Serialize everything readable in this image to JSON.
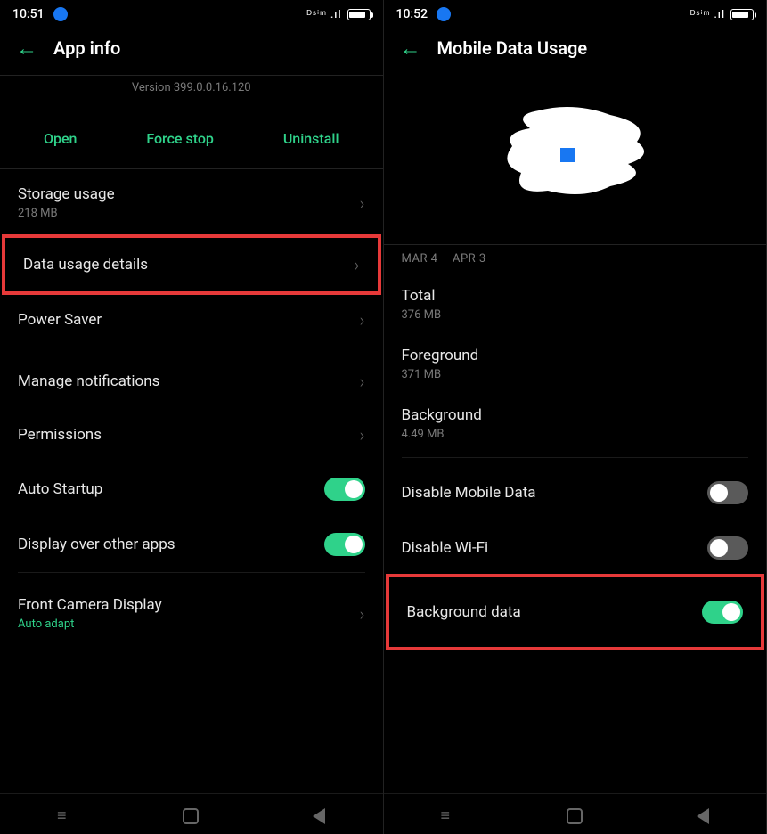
{
  "left": {
    "status": {
      "time": "10:51",
      "signal": "ᴰˢⁱᵐ .ıl"
    },
    "header": {
      "title": "App info"
    },
    "app": {
      "name": "",
      "version": "Version 399.0.0.16.120"
    },
    "actions": {
      "open": "Open",
      "force_stop": "Force stop",
      "uninstall": "Uninstall"
    },
    "items": {
      "storage": {
        "label": "Storage usage",
        "sub": "218 MB"
      },
      "data_usage": {
        "label": "Data usage details"
      },
      "power_saver": {
        "label": "Power Saver"
      },
      "notifications": {
        "label": "Manage notifications"
      },
      "permissions": {
        "label": "Permissions"
      },
      "auto_startup": {
        "label": "Auto Startup"
      },
      "display_over": {
        "label": "Display over other apps"
      },
      "front_camera": {
        "label": "Front Camera Display",
        "sub": "Auto adapt"
      }
    }
  },
  "right": {
    "status": {
      "time": "10:52",
      "signal": "ᴰˢⁱᵐ .ıl"
    },
    "header": {
      "title": "Mobile Data Usage"
    },
    "date_range": "MAR 4 – APR 3",
    "stats": {
      "total": {
        "label": "Total",
        "value": "376 MB"
      },
      "foreground": {
        "label": "Foreground",
        "value": "371 MB"
      },
      "background": {
        "label": "Background",
        "value": "4.49 MB"
      }
    },
    "toggles": {
      "disable_mobile": {
        "label": "Disable Mobile Data"
      },
      "disable_wifi": {
        "label": "Disable Wi-Fi"
      },
      "background_data": {
        "label": "Background data"
      }
    }
  }
}
